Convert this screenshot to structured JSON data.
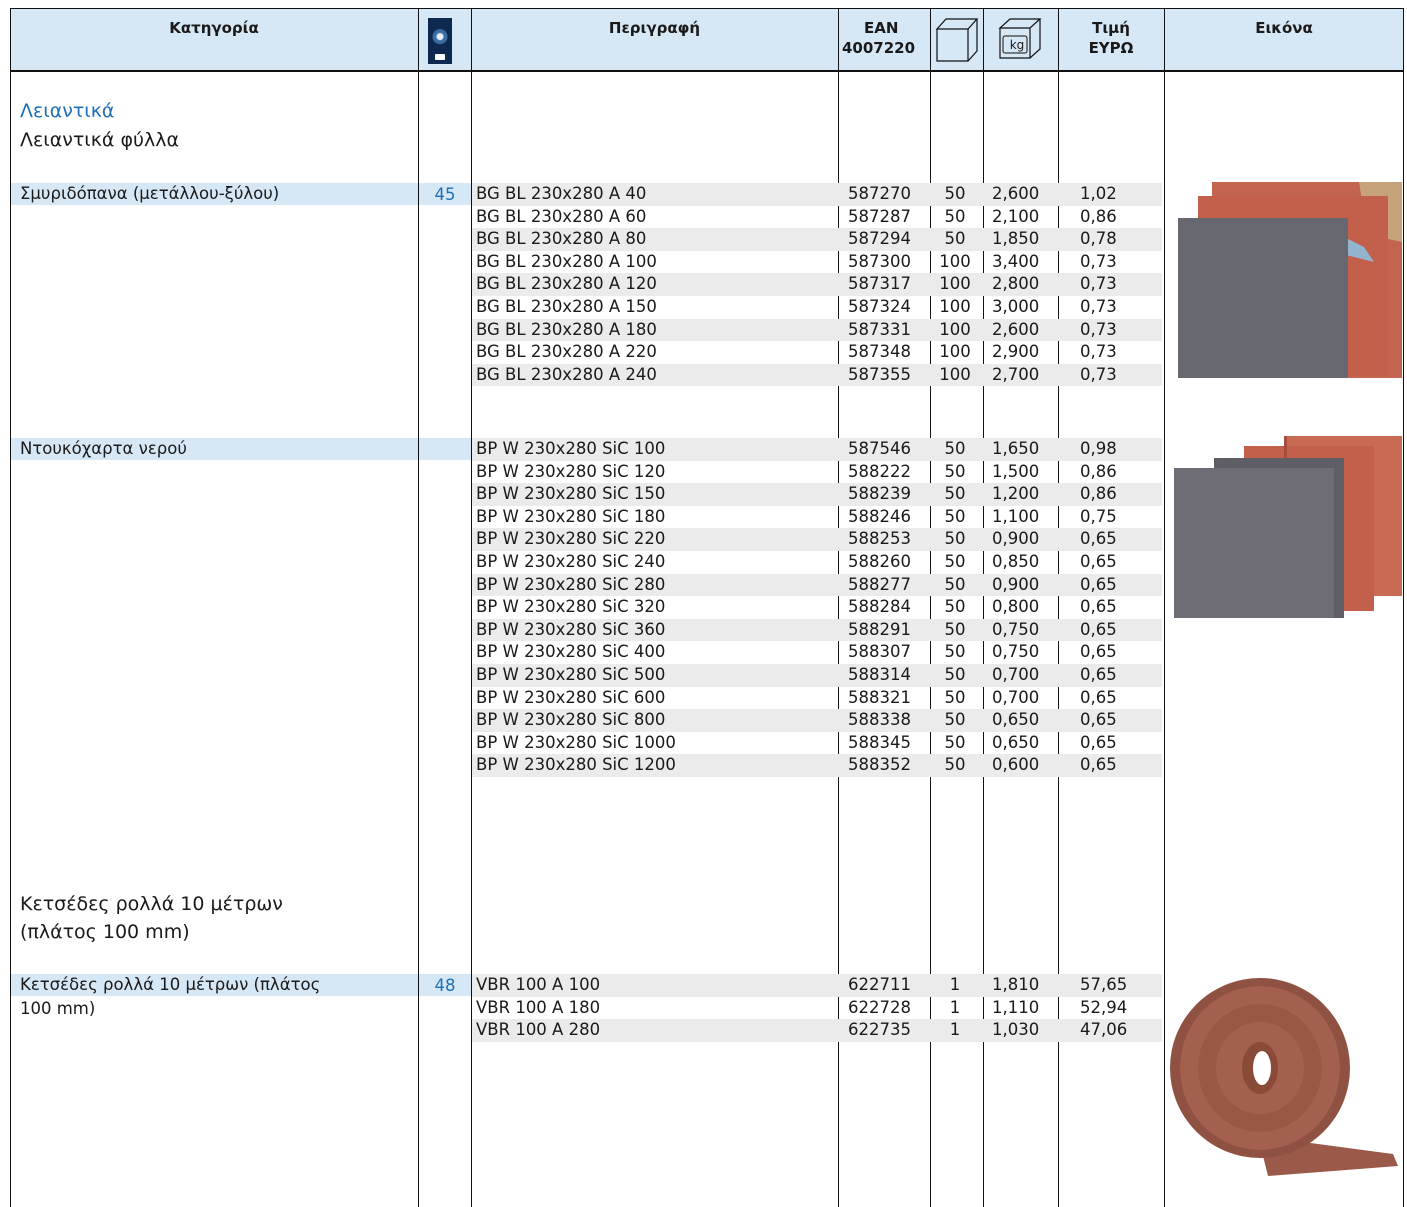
{
  "header": {
    "category": "Κατηγορία",
    "catalog_icon": "catalog-page-icon",
    "description": "Περιγραφή",
    "ean_line1": "EAN",
    "ean_line2": "4007220",
    "pack_icon": "box-icon",
    "weight_icon": "box-kg-icon",
    "weight_label": "kg",
    "price_line1": "Τιμή",
    "price_line2": "ΕΥΡΩ",
    "image": "Εικόνα"
  },
  "sections": {
    "main_title": "Λειαντικά",
    "sub_title": "Λειαντικά φύλλα",
    "rolls_title_1": "Κετσέδες ρολλά 10 μέτρων",
    "rolls_title_2": "(πλάτος  100 mm)"
  },
  "groups": [
    {
      "category": "Σμυριδόπανα  (μετάλλου-ξύλου)",
      "page": "45",
      "image": "sanding-sheets-photo",
      "rows": [
        {
          "desc": "BG BL 230x280 A 40",
          "ean": "587270",
          "pack": "50",
          "kg": "2,600",
          "price": "1,02"
        },
        {
          "desc": "BG BL 230x280 A 60",
          "ean": "587287",
          "pack": "50",
          "kg": "2,100",
          "price": "0,86"
        },
        {
          "desc": "BG BL 230x280 A 80",
          "ean": "587294",
          "pack": "50",
          "kg": "1,850",
          "price": "0,78"
        },
        {
          "desc": "BG BL 230x280 A 100",
          "ean": "587300",
          "pack": "100",
          "kg": "3,400",
          "price": "0,73"
        },
        {
          "desc": "BG BL 230x280 A 120",
          "ean": "587317",
          "pack": "100",
          "kg": "2,800",
          "price": "0,73"
        },
        {
          "desc": "BG BL 230x280 A 150",
          "ean": "587324",
          "pack": "100",
          "kg": "3,000",
          "price": "0,73"
        },
        {
          "desc": "BG BL 230x280 A 180",
          "ean": "587331",
          "pack": "100",
          "kg": "2,600",
          "price": "0,73"
        },
        {
          "desc": "BG BL 230x280 A 220",
          "ean": "587348",
          "pack": "100",
          "kg": "2,900",
          "price": "0,73"
        },
        {
          "desc": "BG BL 230x280 A 240",
          "ean": "587355",
          "pack": "100",
          "kg": "2,700",
          "price": "0,73"
        }
      ]
    },
    {
      "category": "Ντουκόχαρτα νερού",
      "page": "",
      "image": "waterproof-paper-photo",
      "rows": [
        {
          "desc": "BP W 230x280 SiC 100",
          "ean": "587546",
          "pack": "50",
          "kg": "1,650",
          "price": "0,98"
        },
        {
          "desc": "BP W 230x280 SiC 120",
          "ean": "588222",
          "pack": "50",
          "kg": "1,500",
          "price": "0,86"
        },
        {
          "desc": "BP W 230x280 SiC 150",
          "ean": "588239",
          "pack": "50",
          "kg": "1,200",
          "price": "0,86"
        },
        {
          "desc": "BP W 230x280 SiC 180",
          "ean": "588246",
          "pack": "50",
          "kg": "1,100",
          "price": "0,75"
        },
        {
          "desc": "BP W 230x280 SiC 220",
          "ean": "588253",
          "pack": "50",
          "kg": "0,900",
          "price": "0,65"
        },
        {
          "desc": "BP W 230x280 SiC 240",
          "ean": "588260",
          "pack": "50",
          "kg": "0,850",
          "price": "0,65"
        },
        {
          "desc": "BP W 230x280 SiC 280",
          "ean": "588277",
          "pack": "50",
          "kg": "0,900",
          "price": "0,65"
        },
        {
          "desc": "BP W 230x280 SiC 320",
          "ean": "588284",
          "pack": "50",
          "kg": "0,800",
          "price": "0,65"
        },
        {
          "desc": "BP W 230x280 SiC 360",
          "ean": "588291",
          "pack": "50",
          "kg": "0,750",
          "price": "0,65"
        },
        {
          "desc": "BP W 230x280 SiC 400",
          "ean": "588307",
          "pack": "50",
          "kg": "0,750",
          "price": "0,65"
        },
        {
          "desc": "BP W 230x280 SiC 500",
          "ean": "588314",
          "pack": "50",
          "kg": "0,700",
          "price": "0,65"
        },
        {
          "desc": "BP W 230x280 SiC 600",
          "ean": "588321",
          "pack": "50",
          "kg": "0,700",
          "price": "0,65"
        },
        {
          "desc": "BP W 230x280 SiC 800",
          "ean": "588338",
          "pack": "50",
          "kg": "0,650",
          "price": "0,65"
        },
        {
          "desc": "BP W 230x280 SiC 1000",
          "ean": "588345",
          "pack": "50",
          "kg": "0,650",
          "price": "0,65"
        },
        {
          "desc": "BP W 230x280 SiC 1200",
          "ean": "588352",
          "pack": "50",
          "kg": "0,600",
          "price": "0,65"
        }
      ]
    },
    {
      "category": "Κετσέδες ρολλά 10 μέτρων (πλάτος 100 mm)",
      "category_line1": "Κετσέδες ρολλά 10 μέτρων (πλάτος",
      "category_line2": "100 mm)",
      "page": "48",
      "image": "abrasive-roll-photo",
      "rows": [
        {
          "desc": "VBR 100 A 100",
          "ean": "622711",
          "pack": "1",
          "kg": "1,810",
          "price": "57,65"
        },
        {
          "desc": "VBR 100 A 180",
          "ean": "622728",
          "pack": "1",
          "kg": "1,110",
          "price": "52,94"
        },
        {
          "desc": "VBR 100 A 280",
          "ean": "622735",
          "pack": "1",
          "kg": "1,030",
          "price": "47,06"
        }
      ]
    }
  ],
  "colors": {
    "header_bg": "#d6e7f5",
    "band_bg": "#d6e7f5",
    "row_shade": "#ebebeb",
    "accent_blue": "#1f6fb4",
    "sheet_red": "#c96a55",
    "sheet_grey": "#6e6d75",
    "roll_brown": "#9b5a49"
  }
}
